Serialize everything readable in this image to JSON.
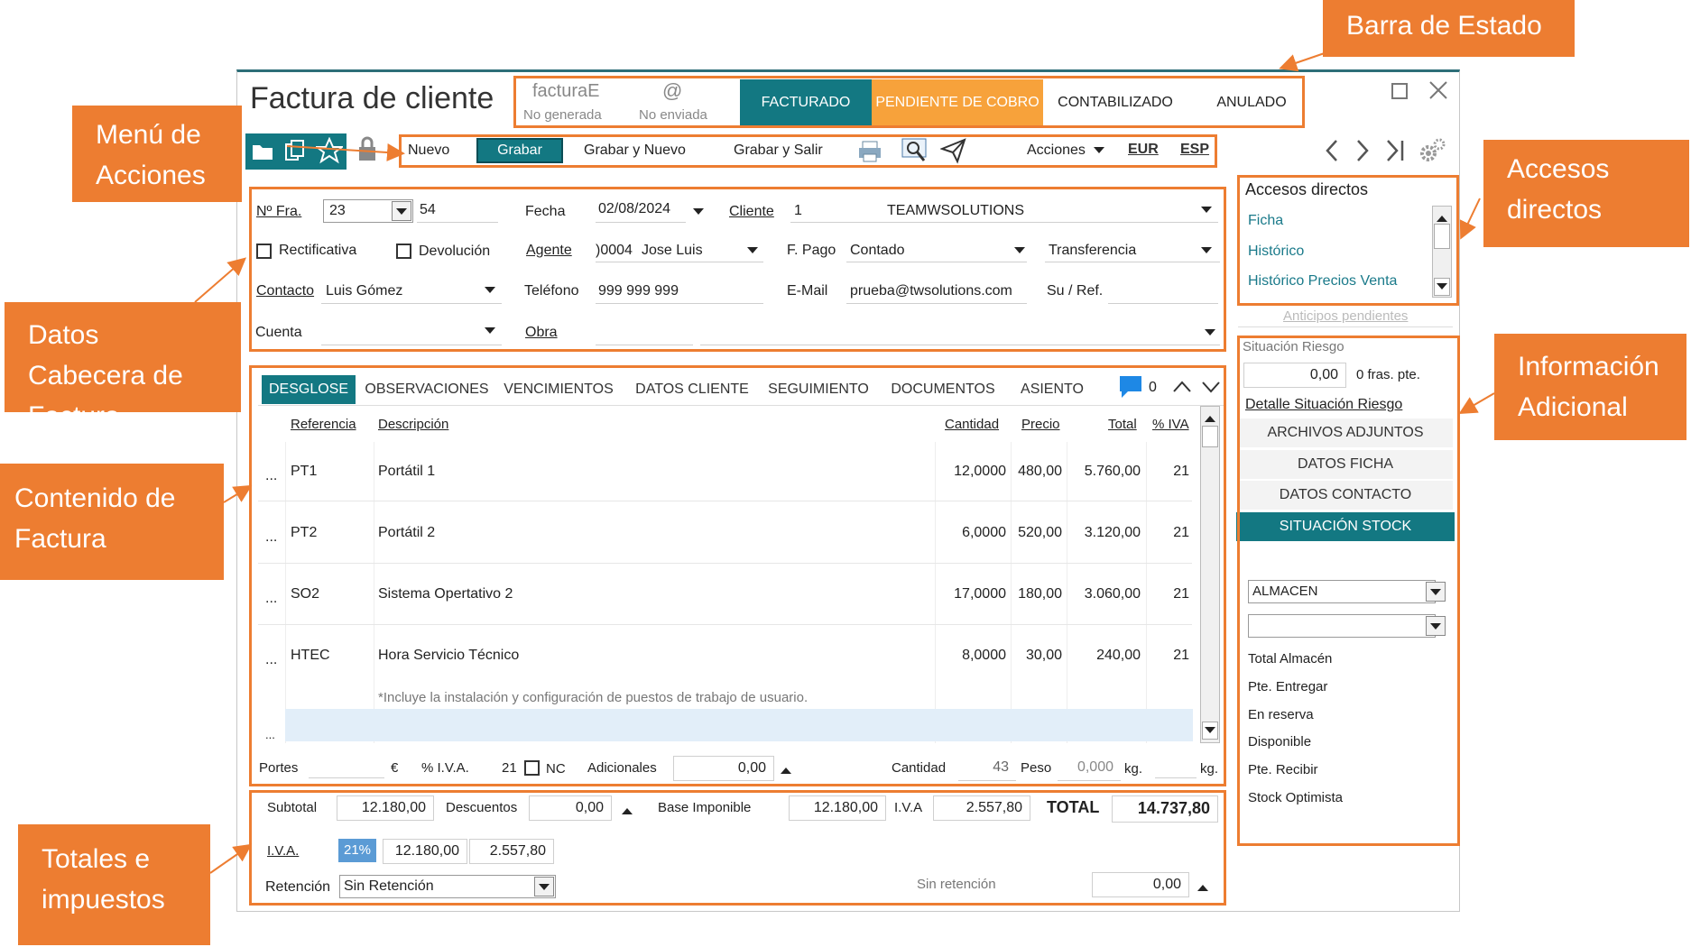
{
  "callouts": {
    "estado": "Barra de Estado",
    "menu": "Menú de Acciones",
    "accesos": "Accesos directos",
    "cabecera": "Datos Cabecera de Factura",
    "info": "Información Adicional",
    "contenido": "Contenido de Factura",
    "totales": "Totales e impuestos"
  },
  "window": {
    "title": "Factura de cliente"
  },
  "status": {
    "factura_e": "facturaE",
    "no_generada": "No generada",
    "at": "@",
    "no_enviada": "No enviada",
    "facturado": "FACTURADO",
    "pendiente": "PENDIENTE DE COBRO",
    "contabilizado": "CONTABILIZADO",
    "anulado": "ANULADO"
  },
  "toolbar": {
    "nuevo": "Nuevo",
    "grabar": "Grabar",
    "grabar_nuevo": "Grabar y Nuevo",
    "grabar_salir": "Grabar y Salir",
    "acciones": "Acciones",
    "eur": "EUR",
    "esp": "ESP"
  },
  "header": {
    "nfra_label": "Nº Fra.",
    "nfra_serie": "23",
    "nfra_num": "54",
    "fecha_label": "Fecha",
    "fecha_value": "02/08/2024",
    "cliente_label": "Cliente",
    "cliente_code": "1",
    "cliente_name": "TEAMWSOLUTIONS",
    "rectificativa": "Rectificativa",
    "devolucion": "Devolución",
    "agente_label": "Agente",
    "agente_code": ")0004",
    "agente_name": "Jose Luis",
    "fpago_label": "F. Pago",
    "fpago_value": "Contado",
    "fpago_tipo": "Transferencia",
    "contacto_label": "Contacto",
    "contacto_value": "Luis Gómez",
    "telefono_label": "Teléfono",
    "telefono_value": "999 999 999",
    "email_label": "E-Mail",
    "email_value": "prueba@twsolutions.com",
    "suref_label": "Su / Ref.",
    "cuenta_label": "Cuenta",
    "obra_label": "Obra"
  },
  "tabs": [
    "DESGLOSE",
    "OBSERVACIONES",
    "VENCIMIENTOS",
    "DATOS CLIENTE",
    "SEGUIMIENTO",
    "DOCUMENTOS",
    "ASIENTO"
  ],
  "comment_count": "0",
  "columns": {
    "referencia": "Referencia",
    "descripcion": "Descripción",
    "cantidad": "Cantidad",
    "precio": "Precio",
    "total": "Total",
    "iva": "% IVA"
  },
  "lines": [
    {
      "ellipsis": "...",
      "ref": "PT1",
      "desc": "Portátil 1",
      "cantidad": "12,0000",
      "precio": "480,00",
      "total": "5.760,00",
      "iva": "21"
    },
    {
      "ellipsis": "...",
      "ref": "PT2",
      "desc": "Portátil 2",
      "cantidad": "6,0000",
      "precio": "520,00",
      "total": "3.120,00",
      "iva": "21"
    },
    {
      "ellipsis": "...",
      "ref": "SO2",
      "desc": "Sistema Opertativo 2",
      "cantidad": "17,0000",
      "precio": "180,00",
      "total": "3.060,00",
      "iva": "21"
    },
    {
      "ellipsis": "...",
      "ref": "HTEC",
      "desc": "Hora Servicio Técnico",
      "cantidad": "8,0000",
      "precio": "30,00",
      "total": "240,00",
      "iva": "21"
    }
  ],
  "line_note": "*Incluye la instalación y configuración de puestos de trabajo de usuario.",
  "empty_ellipsis": "...",
  "footer_line": {
    "portes": "Portes",
    "euro": "€",
    "iva_label": "% I.V.A.",
    "iva_value": "21",
    "nc": "NC",
    "adicionales": "Adicionales",
    "adicionales_value": "0,00",
    "cantidad_label": "Cantidad",
    "cantidad_value": "43",
    "peso_label": "Peso",
    "peso_value": "0,000",
    "kg1": "kg.",
    "kg2": "kg."
  },
  "totals": {
    "subtotal_label": "Subtotal",
    "subtotal": "12.180,00",
    "descuentos_label": "Descuentos",
    "descuentos": "0,00",
    "base_label": "Base Imponible",
    "base": "12.180,00",
    "iva_label": "I.V.A",
    "iva": "2.557,80",
    "total_label": "TOTAL",
    "total": "14.737,80",
    "iva_row_label": "I.V.A.",
    "iva_pct": "21%",
    "iva_base": "12.180,00",
    "iva_cuota": "2.557,80",
    "retencion_label": "Retención",
    "retencion_value": "Sin Retención",
    "sin_retencion_label": "Sin retención",
    "sin_retencion_value": "0,00"
  },
  "side": {
    "accesos_title": "Accesos directos",
    "links": [
      "Ficha",
      "Histórico",
      "Histórico Precios Venta"
    ],
    "anticipos": "Anticipos pendientes",
    "riesgo_label": "Situación Riesgo",
    "riesgo_value": "0,00",
    "riesgo_fras": "0 fras. pte.",
    "detalle_riesgo": "Detalle Situación Riesgo",
    "buttons": [
      "ARCHIVOS ADJUNTOS",
      "DATOS FICHA",
      "DATOS CONTACTO",
      "SITUACIÓN STOCK"
    ],
    "almacen": "ALMACEN",
    "stock_labels": [
      "Total Almacén",
      "Pte. Entregar",
      "En reserva",
      "Disponible",
      "Pte. Recibir",
      "Stock Optimista"
    ]
  },
  "colors": {
    "accent": "#ED7D31",
    "teal": "#137882",
    "pending": "#F7A23B",
    "link": "#1a7a8a",
    "selected_iva": "#5b9bd5"
  }
}
